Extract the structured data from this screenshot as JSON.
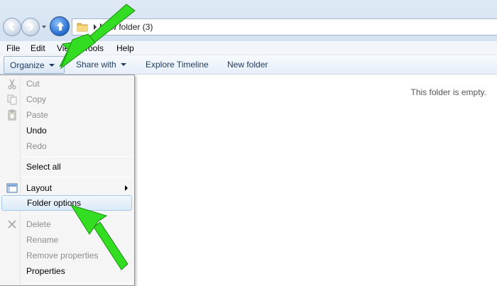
{
  "address": {
    "path_label": "New folder (3)",
    "icons": [
      "back-icon",
      "forward-icon",
      "up-icon",
      "folder-icon"
    ]
  },
  "menubar": {
    "items": [
      "File",
      "Edit",
      "View",
      "Tools",
      "Help"
    ]
  },
  "commandbar": {
    "organize": "Organize",
    "share_with": "Share with",
    "explore_timeline": "Explore Timeline",
    "new_folder": "New folder"
  },
  "content": {
    "empty_message": "This folder is empty."
  },
  "organize_menu": {
    "items": [
      {
        "label": "Cut",
        "enabled": false,
        "icon": "scissors-icon"
      },
      {
        "label": "Copy",
        "enabled": false,
        "icon": "copy-icon"
      },
      {
        "label": "Paste",
        "enabled": false,
        "icon": "paste-icon"
      },
      {
        "label": "Undo",
        "enabled": true
      },
      {
        "label": "Redo",
        "enabled": false
      },
      {
        "label": "Select all",
        "enabled": true
      },
      {
        "label": "Layout",
        "enabled": true,
        "icon": "layout-icon",
        "submenu": true
      },
      {
        "label": "Folder options",
        "enabled": true,
        "highlighted": true
      },
      {
        "label": "Delete",
        "enabled": false,
        "icon": "delete-icon"
      },
      {
        "label": "Rename",
        "enabled": false
      },
      {
        "label": "Remove properties",
        "enabled": false
      },
      {
        "label": "Properties",
        "enabled": true
      }
    ]
  },
  "colors": {
    "annotation_arrow": "#33dd22",
    "highlight_border": "#a9c9ea"
  }
}
